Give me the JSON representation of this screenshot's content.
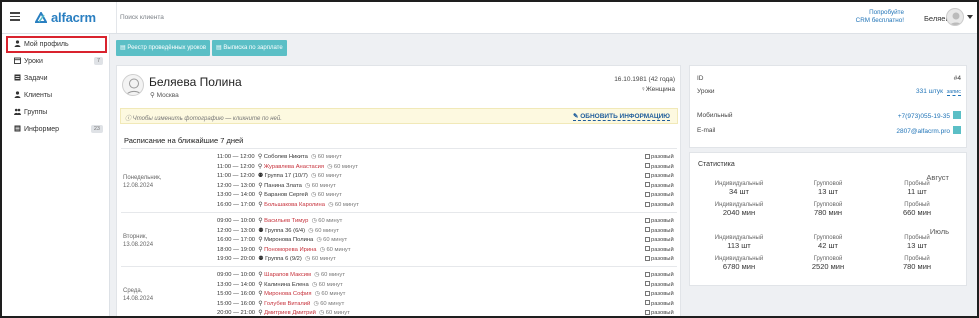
{
  "header": {
    "search_placeholder": "Поиск клиента",
    "promo_line1": "Попробуйте",
    "promo_line2": "CRM бесплатно!",
    "user": "Беляева",
    "logo": "alfacrm"
  },
  "sidebar": {
    "items": [
      {
        "label": "Мой профиль",
        "icon": "user-icon",
        "badge": ""
      },
      {
        "label": "Уроки",
        "icon": "calendar-icon",
        "badge": "7"
      },
      {
        "label": "Задачи",
        "icon": "tasks-icon",
        "badge": ""
      },
      {
        "label": "Клиенты",
        "icon": "user-icon",
        "badge": ""
      },
      {
        "label": "Группы",
        "icon": "users-icon",
        "badge": ""
      },
      {
        "label": "Информер",
        "icon": "list-icon",
        "badge": "23"
      }
    ]
  },
  "toolbar": {
    "btn1": "Реестр проведённых уроков",
    "btn2": "Выписка по зарплате"
  },
  "profile": {
    "name": "Беляева Полина",
    "city": "Москва",
    "dob": "16.10.1981 (42 года)",
    "gender": "Женщина",
    "notice": "Чтобы изменить фотографию — кликните по ней.",
    "update_btn": "ОБНОВИТЬ ИНФОРМАЦИЮ",
    "schedule_title": "Расписание на ближайшие 7 дней"
  },
  "schedule": [
    {
      "day": "Понедельник,",
      "date": "12.08.2024",
      "lessons": [
        {
          "time": "11:00 — 12:00",
          "who": "Соболев Никита",
          "red": false,
          "dur": "60 минут",
          "type": "разовый"
        },
        {
          "time": "11:00 — 12:00",
          "who": "Журавлева Анастасия",
          "red": true,
          "dur": "60 минут",
          "type": "разовый"
        },
        {
          "time": "11:00 — 12:00",
          "who": "Группа 17 (10/7)",
          "red": false,
          "dur": "60 минут",
          "type": "разовый"
        },
        {
          "time": "12:00 — 13:00",
          "who": "Панина Злата",
          "red": false,
          "dur": "60 минут",
          "type": "разовый"
        },
        {
          "time": "13:00 — 14:00",
          "who": "Баранов Сергей",
          "red": false,
          "dur": "60 минут",
          "type": "разовый"
        },
        {
          "time": "16:00 — 17:00",
          "who": "Большакова Каролина",
          "red": true,
          "dur": "60 минут",
          "type": "разовый"
        }
      ]
    },
    {
      "day": "Вторник,",
      "date": "13.08.2024",
      "lessons": [
        {
          "time": "09:00 — 10:00",
          "who": "Васильев Тимур",
          "red": true,
          "dur": "60 минут",
          "type": "разовый"
        },
        {
          "time": "12:00 — 13:00",
          "who": "Группа 36 (6/4)",
          "red": false,
          "dur": "60 минут",
          "type": "разовый"
        },
        {
          "time": "16:00 — 17:00",
          "who": "Миронова Полина",
          "red": false,
          "dur": "60 минут",
          "type": "разовый"
        },
        {
          "time": "18:00 — 19:00",
          "who": "Пономорева Ирина",
          "red": true,
          "dur": "60 минут",
          "type": "разовый"
        },
        {
          "time": "19:00 — 20:00",
          "who": "Группа 6 (9/2)",
          "red": false,
          "dur": "60 минут",
          "type": "разовый"
        }
      ]
    },
    {
      "day": "Среда,",
      "date": "14.08.2024",
      "lessons": [
        {
          "time": "09:00 — 10:00",
          "who": "Шарапов Максим",
          "red": true,
          "dur": "60 минут",
          "type": "разовый"
        },
        {
          "time": "13:00 — 14:00",
          "who": "Калинина Елена",
          "red": false,
          "dur": "60 минут",
          "type": "разовый"
        },
        {
          "time": "15:00 — 16:00",
          "who": "Миронова София",
          "red": true,
          "dur": "60 минут",
          "type": "разовый"
        },
        {
          "time": "15:00 — 16:00",
          "who": "Голубев Виталий",
          "red": true,
          "dur": "60 минут",
          "type": "разовый"
        },
        {
          "time": "20:00 — 21:00",
          "who": "Дмитриев Дмитрий",
          "red": true,
          "dur": "60 минут",
          "type": "разовый"
        }
      ]
    }
  ],
  "info": {
    "id_label": "ID",
    "id_value": "#4",
    "lessons_label": "Уроки",
    "lessons_value": "331 штук",
    "lessons_link": "запис",
    "mobile_label": "Мобильный",
    "mobile_value": "+7(973)055-19-35",
    "email_label": "E-mail",
    "email_value": "2807@alfacrm.pro"
  },
  "stats": {
    "title": "Статистика",
    "months": [
      {
        "name": "Август",
        "cells": [
          {
            "label": "Индивидуальный",
            "value": "34 шт"
          },
          {
            "label": "Групповой",
            "value": "13 шт"
          },
          {
            "label": "Пробный",
            "value": "11 шт"
          },
          {
            "label": "Индивидуальный",
            "value": "2040 мин"
          },
          {
            "label": "Групповой",
            "value": "780 мин"
          },
          {
            "label": "Пробный",
            "value": "660 мин"
          }
        ]
      },
      {
        "name": "Июль",
        "cells": [
          {
            "label": "Индивидуальный",
            "value": "113 шт"
          },
          {
            "label": "Групповой",
            "value": "42 шт"
          },
          {
            "label": "Пробный",
            "value": "13 шт"
          },
          {
            "label": "Индивидуальный",
            "value": "6780 мин"
          },
          {
            "label": "Групповой",
            "value": "2520 мин"
          },
          {
            "label": "Пробный",
            "value": "780 мин"
          }
        ]
      }
    ]
  }
}
